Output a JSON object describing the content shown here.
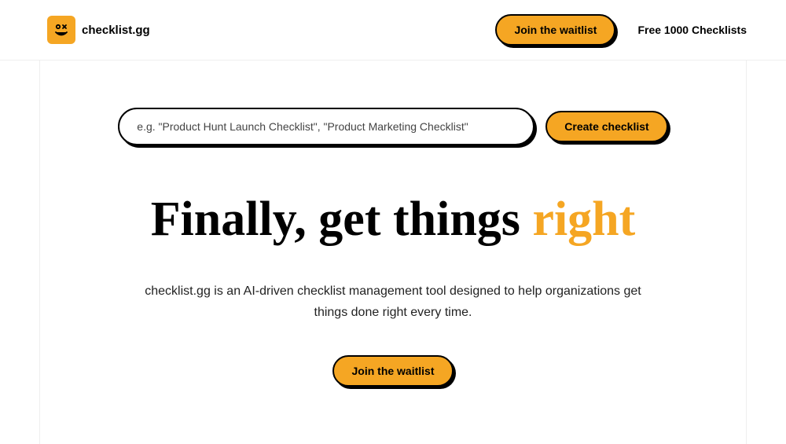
{
  "brand": {
    "name": "checklist.gg",
    "accent_color": "#f5a623"
  },
  "header": {
    "join_waitlist_label": "Join the waitlist",
    "free_checklists_label": "Free 1000 Checklists"
  },
  "search": {
    "placeholder": "e.g. \"Product Hunt Launch Checklist\", \"Product Marketing Checklist\"",
    "create_button_label": "Create checklist"
  },
  "hero": {
    "title_prefix": "Finally, get things ",
    "title_accent": "right",
    "subtitle": "checklist.gg is an AI-driven checklist management tool designed to help organizations get things done right every time.",
    "cta_label": "Join the waitlist"
  }
}
